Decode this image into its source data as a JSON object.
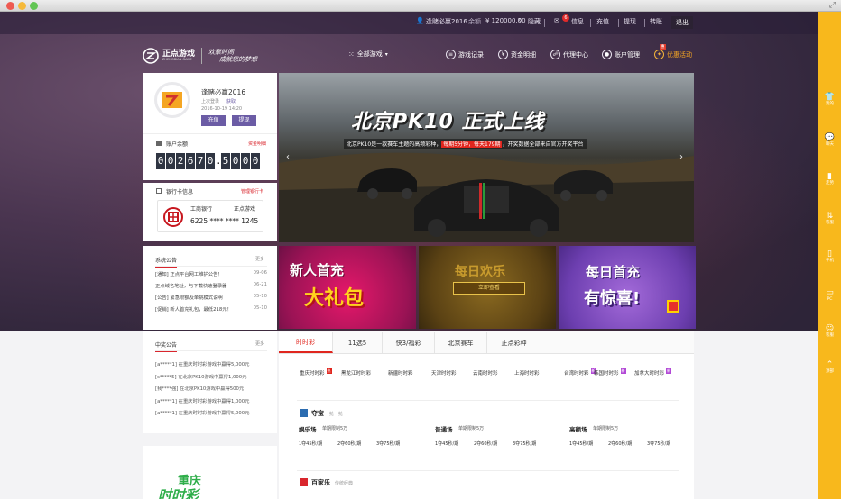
{
  "topbar": {
    "username": "逢赌必赢2016",
    "balance_label": "余额",
    "balance": "¥ 120000.00",
    "hide_label": "隐藏",
    "msg_count": "6",
    "messages": "信息",
    "deposit": "充值",
    "withdraw": "提现",
    "transfer": "转账",
    "logout": "退出"
  },
  "logo": {
    "brand": "正点游戏",
    "brand_en": "ZHENGDIAN GAME",
    "slogan1": "欢聚时间",
    "slogan2": "成就您的梦想"
  },
  "nav": {
    "all_games": "全部游戏",
    "game_record": "游戏记录",
    "fund_detail": "资金明细",
    "agent_center": "代理中心",
    "account_mgmt": "账户管理",
    "promotions": "优惠活动",
    "promo_badge": "惠"
  },
  "user": {
    "name": "逢赌必赢2016",
    "last_login_label": "上次登录",
    "last_login_time": "2016-10-19 14:20",
    "exit_label": "获取",
    "deposit_btn": "充值",
    "withdraw_btn": "提现"
  },
  "account": {
    "title": "账户余额",
    "link": "资金明细",
    "digits": [
      "0",
      "0",
      "2",
      "6",
      "7",
      "0",
      ".",
      "5",
      "0",
      "0",
      "0"
    ]
  },
  "bank": {
    "title": "银行卡信息",
    "link": "管理银行卡",
    "bank_name": "工商银行",
    "holder": "正点游戏",
    "card_no": "6225 **** **** 1245"
  },
  "notices": {
    "title": "系统公告",
    "more": "更多",
    "items": [
      {
        "text": "[通知] 正点平台网工维护公告！",
        "date": "09-06"
      },
      {
        "text": "正点域名地址，与下载快速登录器",
        "date": "06-21"
      },
      {
        "text": "[公告] 紧急限额及单挑模式说明",
        "date": "05-10"
      },
      {
        "text": "[促销] 新人首充礼包，最低218元！",
        "date": "05-10"
      }
    ]
  },
  "banner": {
    "title": "北京PK10 正式上线",
    "desc_a": "北京PK10是一款赛车主题的高频彩种，",
    "desc_hl": "每期5分钟，每天179期",
    "desc_b": "，开奖数据全部来自官方开奖平台"
  },
  "promos": {
    "p1": "新人首充",
    "p1b": "大礼包",
    "p2": "每日欢乐",
    "p2b": "立即查看",
    "p3": "每日首充",
    "p3b": "有惊喜!"
  },
  "winners": {
    "title": "中奖公告",
    "more": "更多",
    "items": [
      "[a*****1] 在重庆时时彩游戏中赢得5,000元",
      "[s*****5] 在北京PK10游戏中赢得1,000元",
      "[我****强] 在北京PK10游戏中赢得500元",
      "[a*****1] 在重庆时时彩游戏中赢得1,000元",
      "[a*****1] 在重庆时时彩游戏中赢得5,000元"
    ]
  },
  "cq": {
    "line1": "重庆",
    "line2": "时时彩"
  },
  "tabs": [
    "时时彩",
    "11选5",
    "快3/福彩",
    "北京赛车",
    "正点彩种"
  ],
  "lotteries": [
    {
      "name": "重庆时时彩",
      "badge": "热"
    },
    {
      "name": "黑龙江时时彩",
      "badge": ""
    },
    {
      "name": "新疆时时彩",
      "badge": ""
    },
    {
      "name": "天津时时彩",
      "badge": ""
    },
    {
      "name": "云南时时彩",
      "badge": ""
    },
    {
      "name": "上海时时彩",
      "badge": ""
    },
    {
      "name": "台湾时时彩",
      "badge": "新"
    },
    {
      "name": "韩国时时彩",
      "badge": "新"
    },
    {
      "name": "加拿大时时彩",
      "badge": "新"
    }
  ],
  "duobao": {
    "title": "夺宝",
    "sub": "抢一抢",
    "halls": [
      {
        "name": "娱乐场",
        "limit": "单期限制5万",
        "items": [
          "1夺45秒/期",
          "2夺60秒/期",
          "3夺75秒/期"
        ]
      },
      {
        "name": "普通场",
        "limit": "单期限制5万",
        "items": [
          "1夺45秒/期",
          "2夺60秒/期",
          "3夺75秒/期"
        ]
      },
      {
        "name": "高额场",
        "limit": "单期限制5万",
        "items": [
          "1夺45秒/期",
          "2夺60秒/期",
          "3夺75秒/期"
        ]
      }
    ]
  },
  "baijiale": {
    "title": "百家乐",
    "sub": "传统经典"
  },
  "sidebar": [
    "我的",
    "聊天",
    "走势",
    "客服",
    "手机",
    "PC",
    "客服",
    "顶部"
  ],
  "colors": {
    "accent": "#f8b81c",
    "red": "#d9262d",
    "purple": "#6b5ca5"
  }
}
